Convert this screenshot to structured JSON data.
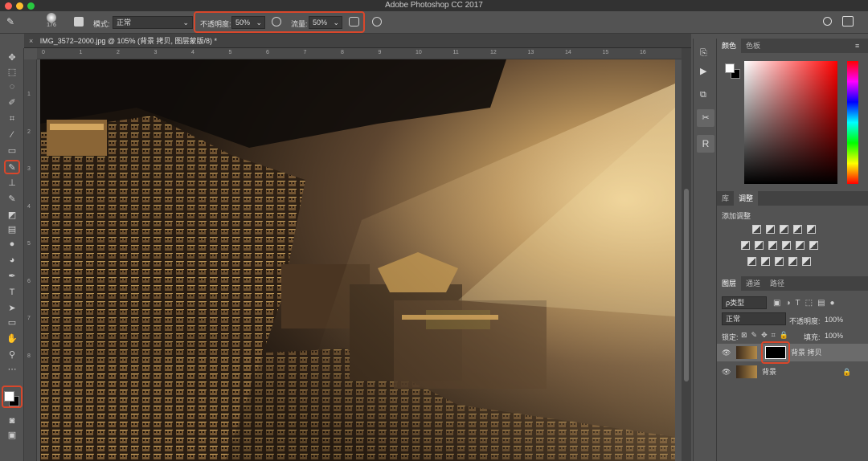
{
  "window": {
    "title": "Adobe Photoshop CC 2017"
  },
  "options": {
    "brush_size": "176",
    "mode_label": "模式:",
    "mode_value": "正常",
    "opacity_label": "不透明度:",
    "opacity_value": "50%",
    "flow_label": "流量:",
    "flow_value": "50%"
  },
  "document": {
    "tab_label": "IMG_3572–2000.jpg @ 105% (背景 拷贝, 图层蒙版/8) *"
  },
  "ruler": {
    "top": [
      "0",
      "1",
      "2",
      "3",
      "4",
      "5",
      "6",
      "7",
      "8",
      "9",
      "10",
      "11",
      "12",
      "13",
      "14",
      "15",
      "16"
    ],
    "left": [
      "1",
      "2",
      "3",
      "4",
      "5",
      "6",
      "7",
      "8"
    ]
  },
  "color_panel": {
    "tabs": [
      "颜色",
      "色板"
    ]
  },
  "adjust_panel": {
    "tabs": [
      "库",
      "调整"
    ],
    "add_label": "添加调整"
  },
  "layers_panel": {
    "tabs": [
      "图层",
      "通道",
      "路径"
    ],
    "filter_label": "ρ类型",
    "blend_mode": "正常",
    "opacity_label": "不透明度:",
    "opacity_value": "100%",
    "lock_label": "锁定:",
    "fill_label": "填充:",
    "fill_value": "100%",
    "layers": [
      {
        "name": "背景 拷贝"
      },
      {
        "name": "背景"
      }
    ]
  },
  "colors": {
    "highlight": "#d9472b",
    "panel_bg": "#535353",
    "dark_bg": "#424242"
  }
}
